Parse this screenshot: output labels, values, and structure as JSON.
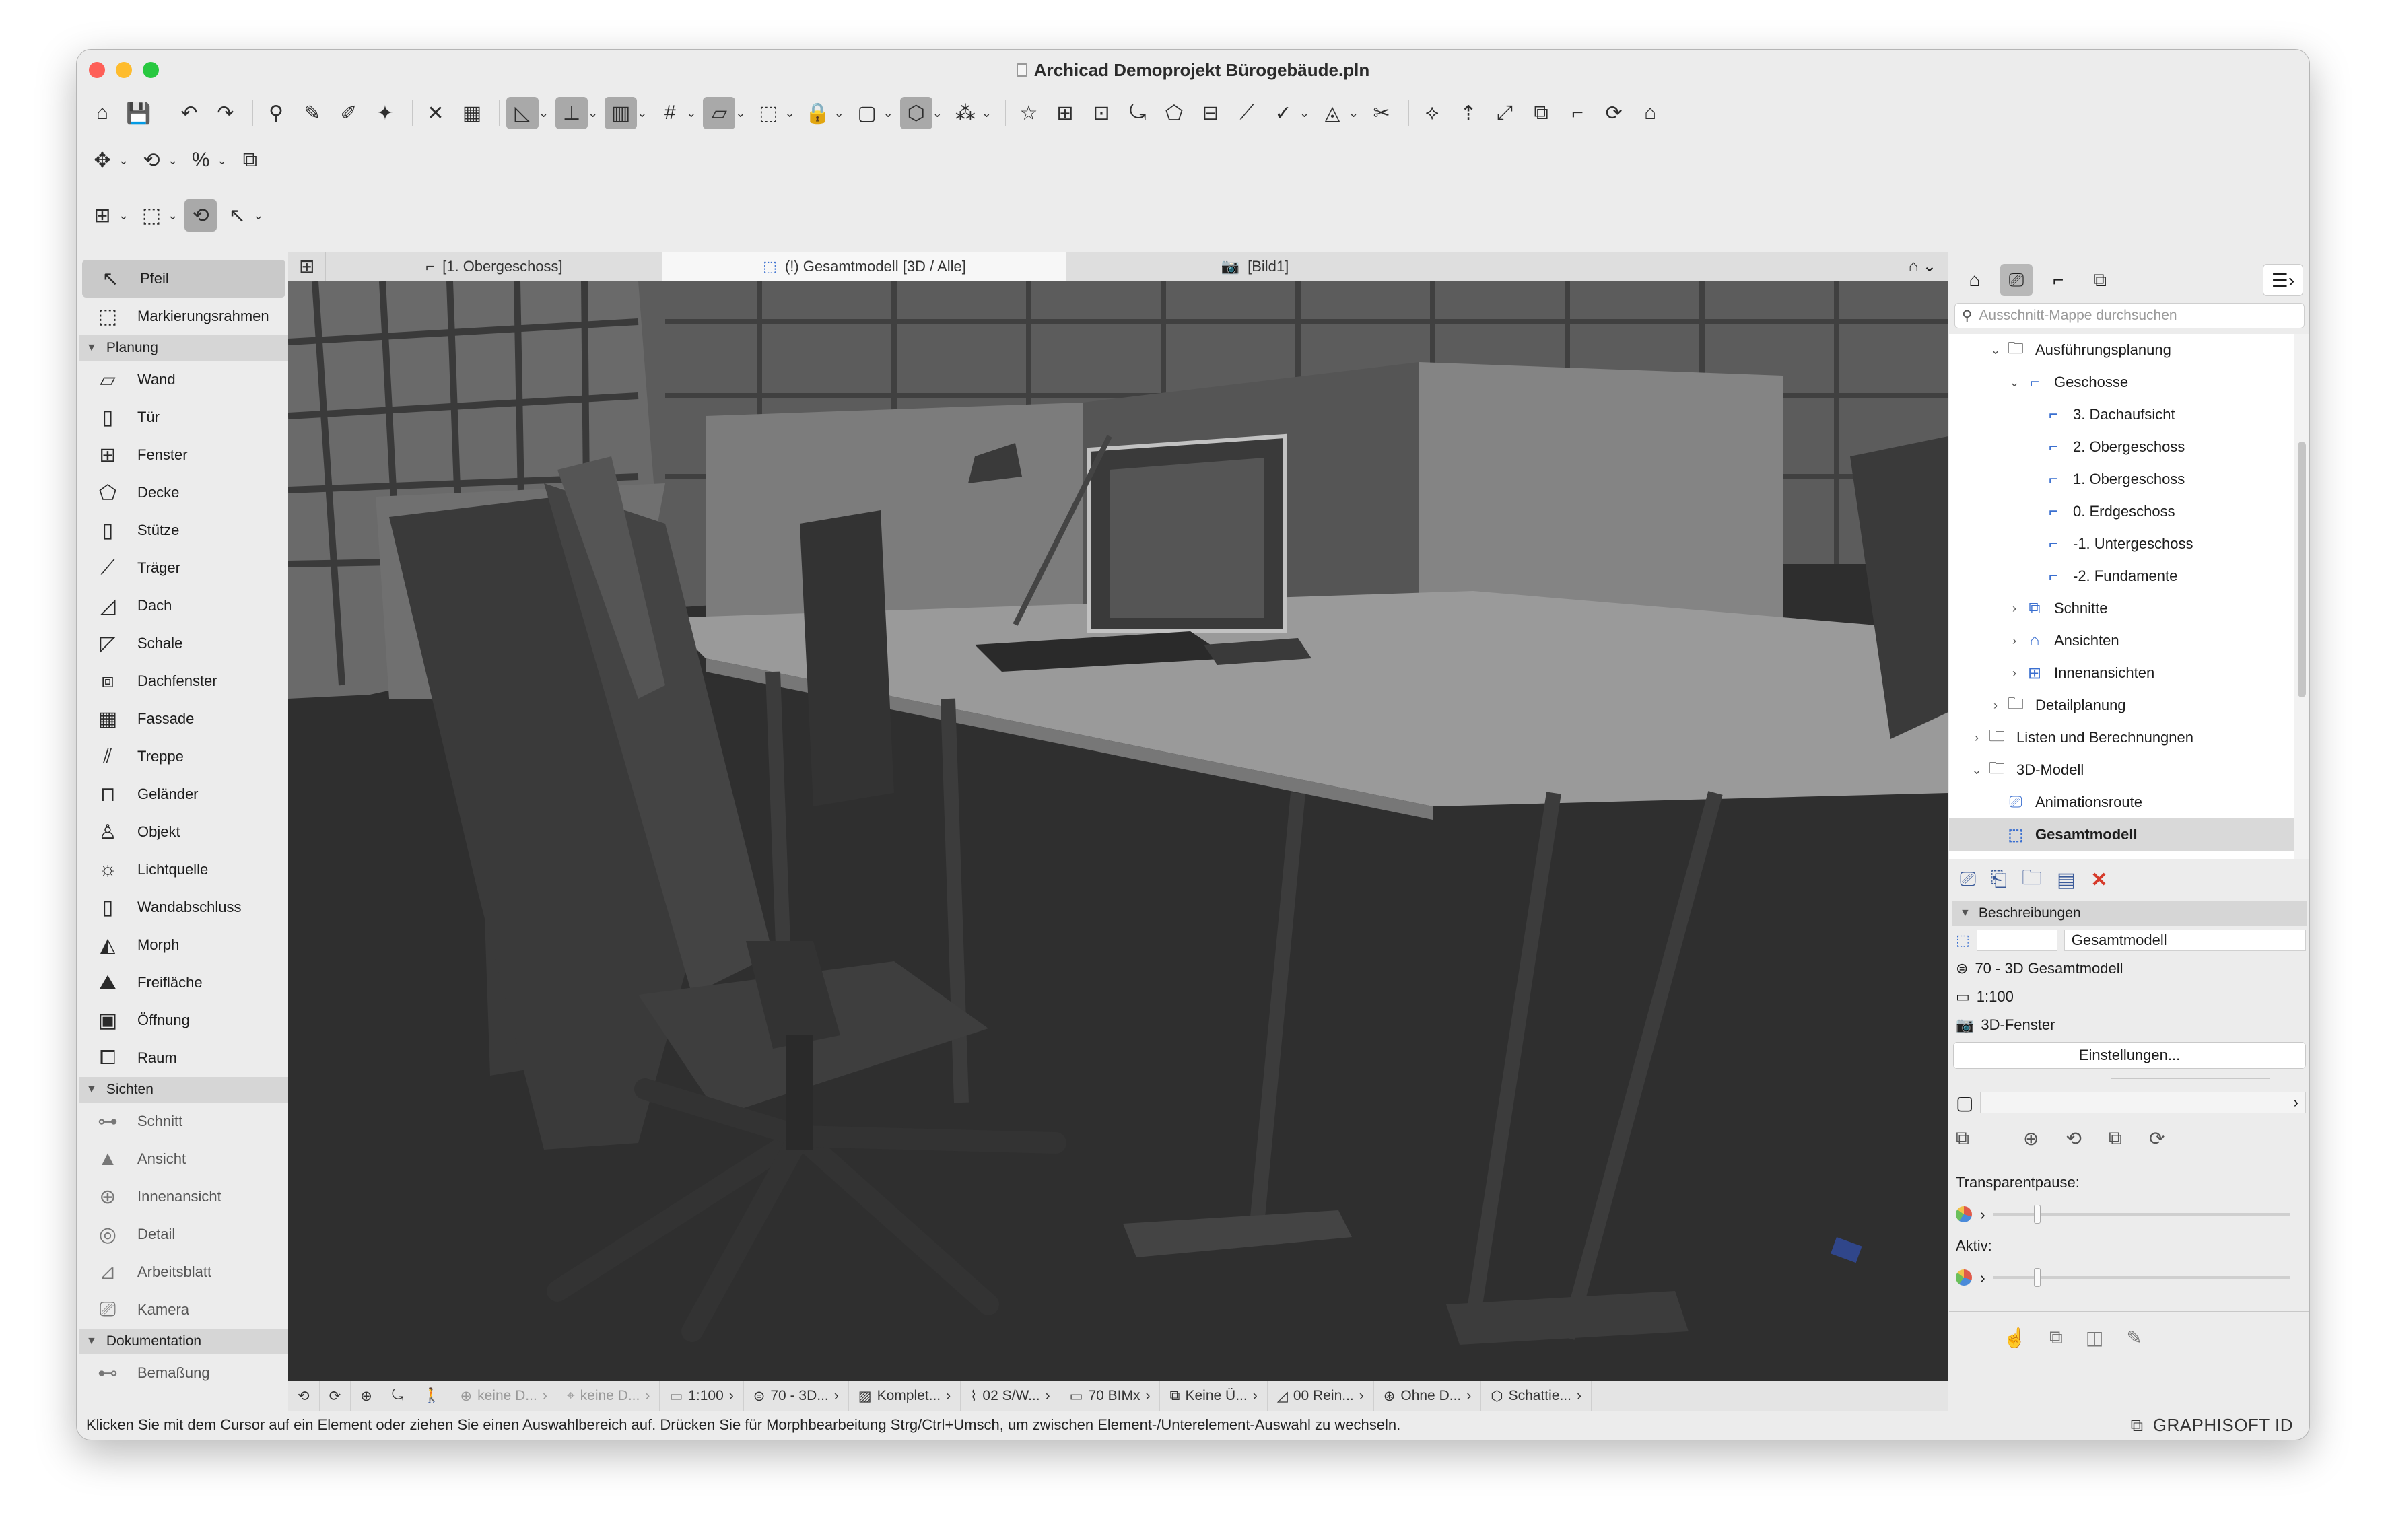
{
  "window": {
    "title": "Archicad Demoprojekt Bürogebäude.pln"
  },
  "traffic_lights": {
    "close": "#fe5f57",
    "minimize": "#febc2e",
    "zoom": "#28c840"
  },
  "toolbar1": [
    {
      "name": "home-icon",
      "glyph": "⌂"
    },
    {
      "name": "save-icon",
      "glyph": "💾"
    },
    {
      "name": "undo-icon",
      "glyph": "↶"
    },
    {
      "name": "redo-icon",
      "glyph": "↷"
    },
    {
      "name": "find-select-icon",
      "glyph": "⚲"
    },
    {
      "name": "eyedropper-icon",
      "glyph": "✎"
    },
    {
      "name": "syringe-icon",
      "glyph": "✐"
    },
    {
      "name": "magic-wand-icon",
      "glyph": "✦"
    },
    {
      "name": "guide-icon",
      "glyph": "✕"
    },
    {
      "name": "dimension-icon",
      "glyph": "▦"
    },
    {
      "name": "angle-icon",
      "glyph": "◺"
    },
    {
      "name": "snap-icon",
      "glyph": "⊥"
    },
    {
      "name": "grid-snap-icon",
      "glyph": "▥"
    },
    {
      "name": "grid-icon",
      "glyph": "#"
    },
    {
      "name": "plane-icon",
      "glyph": "⏥"
    },
    {
      "name": "marquee-icon",
      "glyph": "⬚"
    },
    {
      "name": "lock-icon",
      "glyph": "🔒"
    },
    {
      "name": "layer-icon",
      "glyph": "▢"
    },
    {
      "name": "render-icon",
      "glyph": "⬡"
    },
    {
      "name": "group-icon",
      "glyph": "⁂"
    },
    {
      "name": "favorites-icon",
      "glyph": "☆"
    },
    {
      "name": "3d-icon",
      "glyph": "⊞"
    },
    {
      "name": "section-icon",
      "glyph": "⊡"
    },
    {
      "name": "link-icon",
      "glyph": "⤿"
    },
    {
      "name": "object-icon",
      "glyph": "⬠"
    },
    {
      "name": "schedule-icon",
      "glyph": "⊟"
    },
    {
      "name": "measure-icon",
      "glyph": "⟋"
    },
    {
      "name": "check-icon",
      "glyph": "✓"
    },
    {
      "name": "circle-icon",
      "glyph": "◬"
    },
    {
      "name": "scissors-icon",
      "glyph": "✂"
    },
    {
      "name": "trim-icon",
      "glyph": "⟡"
    },
    {
      "name": "elevate-icon",
      "glyph": "⇡"
    },
    {
      "name": "resize-icon",
      "glyph": "⤢"
    },
    {
      "name": "offset-icon",
      "glyph": "⧉"
    },
    {
      "name": "corner-icon",
      "glyph": "⌐"
    },
    {
      "name": "fillet-icon",
      "glyph": "⟳"
    },
    {
      "name": "roof-icon",
      "glyph": "⌂"
    }
  ],
  "toolbar2": [
    {
      "name": "move-icon",
      "glyph": "✥"
    },
    {
      "name": "rotate-icon",
      "glyph": "⟲"
    },
    {
      "name": "percent-icon",
      "glyph": "%"
    },
    {
      "name": "copy-icon",
      "glyph": "⧉"
    }
  ],
  "toolbar3": [
    {
      "name": "layer-combo-icon",
      "glyph": "⊞"
    },
    {
      "name": "pen-set-icon",
      "glyph": "⬚"
    },
    {
      "name": "orbit-icon",
      "glyph": "⟲"
    },
    {
      "name": "arrow-tool-icon",
      "glyph": "↖"
    }
  ],
  "tabs": [
    {
      "name": "tab-obergeschoss",
      "label": "[1. Obergeschoss]",
      "glyph": "⌐"
    },
    {
      "name": "tab-gesamtmodell",
      "label": "(!) Gesamtmodell [3D / Alle]",
      "glyph": "⬚"
    },
    {
      "name": "tab-bild1",
      "label": "[Bild1]",
      "glyph": "📷"
    }
  ],
  "toolbox": {
    "items": [
      {
        "type": "tool",
        "name": "tool-pfeil",
        "label": "Pfeil",
        "glyph": "↖",
        "sel": true
      },
      {
        "type": "tool",
        "name": "tool-markierungsrahmen",
        "label": "Markierungsrahmen",
        "glyph": "⬚"
      },
      {
        "type": "group",
        "name": "group-planung",
        "label": "Planung"
      },
      {
        "type": "tool",
        "name": "tool-wand",
        "label": "Wand",
        "glyph": "▱"
      },
      {
        "type": "tool",
        "name": "tool-tuer",
        "label": "Tür",
        "glyph": "▯"
      },
      {
        "type": "tool",
        "name": "tool-fenster",
        "label": "Fenster",
        "glyph": "⊞"
      },
      {
        "type": "tool",
        "name": "tool-decke",
        "label": "Decke",
        "glyph": "⬠"
      },
      {
        "type": "tool",
        "name": "tool-stuetze",
        "label": "Stütze",
        "glyph": "▯"
      },
      {
        "type": "tool",
        "name": "tool-traeger",
        "label": "Träger",
        "glyph": "⟋"
      },
      {
        "type": "tool",
        "name": "tool-dach",
        "label": "Dach",
        "glyph": "◿"
      },
      {
        "type": "tool",
        "name": "tool-schale",
        "label": "Schale",
        "glyph": "◸"
      },
      {
        "type": "tool",
        "name": "tool-dachfenster",
        "label": "Dachfenster",
        "glyph": "⧈"
      },
      {
        "type": "tool",
        "name": "tool-fassade",
        "label": "Fassade",
        "glyph": "▦"
      },
      {
        "type": "tool",
        "name": "tool-treppe",
        "label": "Treppe",
        "glyph": "⫽"
      },
      {
        "type": "tool",
        "name": "tool-gelaender",
        "label": "Geländer",
        "glyph": "⊓"
      },
      {
        "type": "tool",
        "name": "tool-objekt",
        "label": "Objekt",
        "glyph": "♙"
      },
      {
        "type": "tool",
        "name": "tool-lichtquelle",
        "label": "Lichtquelle",
        "glyph": "☼"
      },
      {
        "type": "tool",
        "name": "tool-wandabschluss",
        "label": "Wandabschluss",
        "glyph": "▯"
      },
      {
        "type": "tool",
        "name": "tool-morph",
        "label": "Morph",
        "glyph": "◭"
      },
      {
        "type": "tool",
        "name": "tool-freiflaeche",
        "label": "Freifläche",
        "glyph": "⛰"
      },
      {
        "type": "tool",
        "name": "tool-oeffnung",
        "label": "Öffnung",
        "glyph": "▣"
      },
      {
        "type": "tool",
        "name": "tool-raum",
        "label": "Raum",
        "glyph": "⧠"
      },
      {
        "type": "group",
        "name": "group-sichten",
        "label": "Sichten"
      },
      {
        "type": "tool",
        "name": "tool-schnitt",
        "label": "Schnitt",
        "glyph": "⊶",
        "dim": true
      },
      {
        "type": "tool",
        "name": "tool-ansicht",
        "label": "Ansicht",
        "glyph": "▲",
        "dim": true
      },
      {
        "type": "tool",
        "name": "tool-innenansicht",
        "label": "Innenansicht",
        "glyph": "⊕",
        "dim": true
      },
      {
        "type": "tool",
        "name": "tool-detail",
        "label": "Detail",
        "glyph": "◎",
        "dim": true
      },
      {
        "type": "tool",
        "name": "tool-arbeitsblatt",
        "label": "Arbeitsblatt",
        "glyph": "⊿",
        "dim": true
      },
      {
        "type": "tool",
        "name": "tool-kamera",
        "label": "Kamera",
        "glyph": "⎚",
        "dim": true
      },
      {
        "type": "group",
        "name": "group-dokumentation",
        "label": "Dokumentation"
      },
      {
        "type": "tool",
        "name": "tool-bemassung",
        "label": "Bemaßung",
        "glyph": "⊷",
        "dim": true
      }
    ]
  },
  "status_bar": [
    {
      "name": "status-undo",
      "label": "",
      "glyph": "⟲"
    },
    {
      "name": "status-redo",
      "label": "",
      "glyph": "⟳"
    },
    {
      "name": "status-zoom-in",
      "label": "",
      "glyph": "⊕"
    },
    {
      "name": "status-orbit",
      "label": "",
      "glyph": "⤿"
    },
    {
      "name": "status-walk",
      "label": "",
      "glyph": "🚶"
    },
    {
      "name": "status-zoom",
      "label": "keine D...",
      "glyph": "⊕",
      "dim": true
    },
    {
      "name": "status-keine-d2",
      "label": "keine D...",
      "glyph": "⌖",
      "dim": true
    },
    {
      "name": "status-scale",
      "label": "1:100",
      "glyph": "▭"
    },
    {
      "name": "status-layer",
      "label": "70 - 3D...",
      "glyph": "⊜"
    },
    {
      "name": "status-model-view",
      "label": "Komplet...",
      "glyph": "▨"
    },
    {
      "name": "status-pen-set",
      "label": "02 S/W...",
      "glyph": "⌇"
    },
    {
      "name": "status-graphic-override",
      "label": "70 BIMx",
      "glyph": "▭"
    },
    {
      "name": "status-renovation",
      "label": "Keine Ü...",
      "glyph": "⧉"
    },
    {
      "name": "status-structure",
      "label": "00 Rein...",
      "glyph": "◿"
    },
    {
      "name": "status-dim",
      "label": "Ohne D...",
      "glyph": "⊛"
    },
    {
      "name": "status-shadow",
      "label": "Schattie...",
      "glyph": "⬡"
    }
  ],
  "hint_text": "Klicken Sie mit dem Cursor auf ein Element oder ziehen Sie einen Auswahlbereich auf. Drücken Sie für Morphbearbeitung Strg/Ctrl+Umsch, um zwischen Element-/Unterelement-Auswahl zu wechseln.",
  "brand": "GRAPHISOFT ID",
  "navigator": {
    "search_placeholder": "Ausschnitt-Mappe durchsuchen",
    "tree": [
      {
        "name": "tree-ausfuehrungsplanung",
        "label": "Ausführungsplanung",
        "indent": 2,
        "chev": "⌄",
        "glyph": "🗀"
      },
      {
        "name": "tree-geschosse",
        "label": "Geschosse",
        "indent": 3,
        "chev": "⌄",
        "glyph": "⌐"
      },
      {
        "name": "tree-dachaufsicht",
        "label": "3. Dachaufsicht",
        "indent": 4,
        "chev": "",
        "glyph": "⌐"
      },
      {
        "name": "tree-2-obergeschoss",
        "label": "2. Obergeschoss",
        "indent": 4,
        "chev": "",
        "glyph": "⌐"
      },
      {
        "name": "tree-1-obergeschoss",
        "label": "1. Obergeschoss",
        "indent": 4,
        "chev": "",
        "glyph": "⌐"
      },
      {
        "name": "tree-erdgeschoss",
        "label": "0. Erdgeschoss",
        "indent": 4,
        "chev": "",
        "glyph": "⌐"
      },
      {
        "name": "tree-untergeschoss",
        "label": "-1. Untergeschoss",
        "indent": 4,
        "chev": "",
        "glyph": "⌐"
      },
      {
        "name": "tree-fundamente",
        "label": "-2. Fundamente",
        "indent": 4,
        "chev": "",
        "glyph": "⌐"
      },
      {
        "name": "tree-schnitte",
        "label": "Schnitte",
        "indent": 3,
        "chev": "›",
        "glyph": "⧉"
      },
      {
        "name": "tree-ansichten",
        "label": "Ansichten",
        "indent": 3,
        "chev": "›",
        "glyph": "⌂"
      },
      {
        "name": "tree-innenansichten",
        "label": "Innenansichten",
        "indent": 3,
        "chev": "›",
        "glyph": "⊞"
      },
      {
        "name": "tree-detailplanung",
        "label": "Detailplanung",
        "indent": 2,
        "chev": "›",
        "glyph": "🗀"
      },
      {
        "name": "tree-listen",
        "label": "Listen und Berechnungnen",
        "indent": 1,
        "chev": "›",
        "glyph": "🗀"
      },
      {
        "name": "tree-3d-modell",
        "label": "3D-Modell",
        "indent": 1,
        "chev": "⌄",
        "glyph": "🗀"
      },
      {
        "name": "tree-animationsroute",
        "label": "Animationsroute",
        "indent": 2,
        "chev": "",
        "glyph": "⎚"
      },
      {
        "name": "tree-gesamtmodell",
        "label": "Gesamtmodell",
        "indent": 2,
        "chev": "",
        "glyph": "⬚",
        "sel": true
      }
    ]
  },
  "properties": {
    "section_label": "Beschreibungen",
    "name_value": "Gesamtmodell",
    "layer_combo": "70 - 3D Gesamtmodell",
    "scale": "1:100",
    "window_type": "3D-Fenster",
    "settings_button": "Einstellungen...",
    "transparent_label": "Transparentpause:",
    "active_label": "Aktiv:"
  }
}
